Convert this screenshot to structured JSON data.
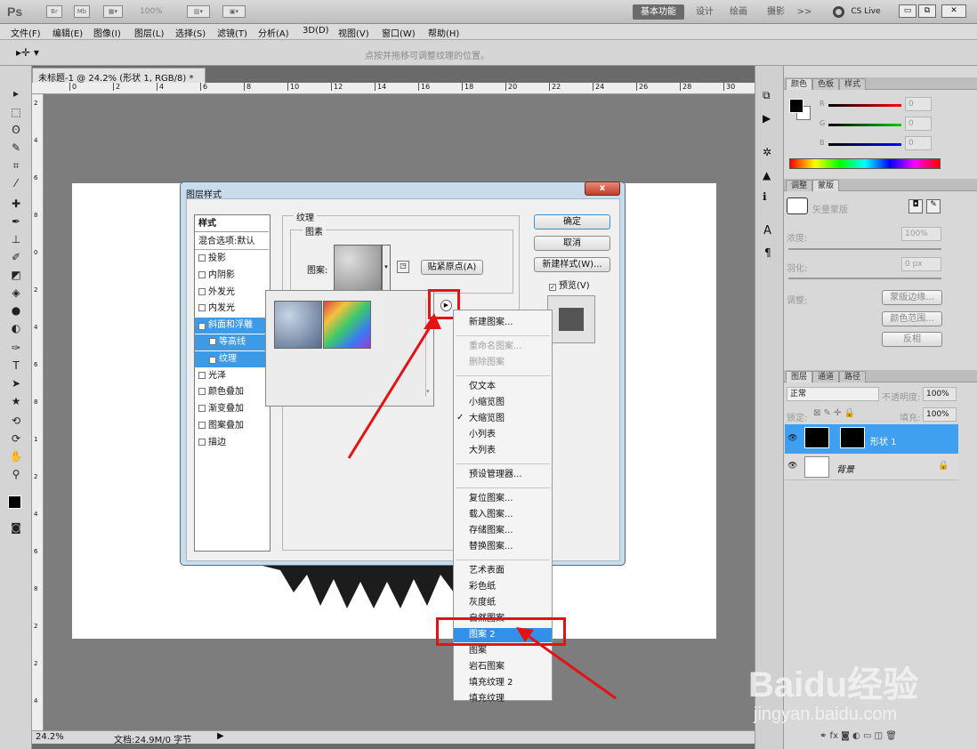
{
  "app": {
    "logo": "Ps",
    "zoom_select": "100%"
  },
  "workspaces": [
    {
      "label": "基本功能",
      "active": true
    },
    {
      "label": "设计"
    },
    {
      "label": "绘画"
    },
    {
      "label": "摄影"
    },
    {
      "label": ">>"
    },
    {
      "label": "CS Live"
    }
  ],
  "menubar": [
    "文件(F)",
    "编辑(E)",
    "图像(I)",
    "图层(L)",
    "选择(S)",
    "滤镜(T)",
    "分析(A)",
    "3D(D)",
    "视图(V)",
    "窗口(W)",
    "帮助(H)"
  ],
  "options_hint": "点按并拖移可调整纹理的位置。",
  "document": {
    "tab_title": "未标题-1 @ 24.2% (形状 1, RGB/8) *",
    "ruler_top": [
      "0",
      "2",
      "4",
      "6",
      "8",
      "10",
      "12",
      "14",
      "16",
      "18",
      "20",
      "22",
      "24",
      "26",
      "28",
      "30"
    ],
    "ruler_left": [
      "2",
      "4",
      "6",
      "8",
      "0",
      "2",
      "4",
      "6",
      "8",
      "1",
      "2",
      "4",
      "6",
      "8",
      "2",
      "2",
      "4"
    ],
    "status_zoom": "24.2%",
    "status_doc": "文档:24.9M/0 字节"
  },
  "color_panel": {
    "tabs": [
      "颜色",
      "色板",
      "样式"
    ],
    "channels": [
      {
        "label": "R",
        "value": "0"
      },
      {
        "label": "G",
        "value": "0"
      },
      {
        "label": "B",
        "value": "0"
      }
    ]
  },
  "masks_panel": {
    "tabs": [
      "调整",
      "蒙版"
    ],
    "mask_label": "矢量蒙版",
    "density_label": "浓度:",
    "density_value": "100%",
    "feather_label": "羽化:",
    "feather_value": "0 px",
    "refine_label": "调整:",
    "buttons": [
      "蒙版边缘...",
      "颜色范围...",
      "反相"
    ]
  },
  "layers_panel": {
    "tabs": [
      "图层",
      "通道",
      "路径"
    ],
    "blend_mode": "正常",
    "opacity_label": "不透明度:",
    "opacity_value": "100%",
    "lock_label": "锁定:",
    "fill_label": "填充:",
    "fill_value": "100%",
    "layers": [
      {
        "name": "形状 1",
        "selected": true
      },
      {
        "name": "背景",
        "selected": false
      }
    ]
  },
  "dialog": {
    "title": "图层样式",
    "close_label": "x",
    "styles_header": "样式",
    "blend_options": "混合选项:默认",
    "styles": [
      {
        "label": "投影",
        "checked": false
      },
      {
        "label": "内阴影",
        "checked": false
      },
      {
        "label": "外发光",
        "checked": false
      },
      {
        "label": "内发光",
        "checked": false
      },
      {
        "label": "斜面和浮雕",
        "checked": true,
        "selected": true
      },
      {
        "label": "等高线",
        "checked": false,
        "selected": true
      },
      {
        "label": "纹理",
        "checked": true,
        "selected": true
      },
      {
        "label": "光泽",
        "checked": false
      },
      {
        "label": "颜色叠加",
        "checked": false
      },
      {
        "label": "渐变叠加",
        "checked": false
      },
      {
        "label": "图案叠加",
        "checked": false
      },
      {
        "label": "描边",
        "checked": false
      }
    ],
    "section_title": "纹理",
    "group_title": "图素",
    "pattern_label": "图案:",
    "snap_button": "贴紧原点(A)",
    "ok": "确定",
    "cancel": "取消",
    "new_style": "新建样式(W)...",
    "preview_label": "预览(V)",
    "preview_checked": true
  },
  "context_menu": [
    {
      "label": "新建图案...",
      "group": 1
    },
    {
      "label": "重命名图案...",
      "disabled": true,
      "group": 2
    },
    {
      "label": "删除图案",
      "disabled": true,
      "group": 2
    },
    {
      "label": "仅文本",
      "group": 3
    },
    {
      "label": "小缩览图",
      "group": 3
    },
    {
      "label": "大缩览图",
      "checked": true,
      "group": 3
    },
    {
      "label": "小列表",
      "group": 3
    },
    {
      "label": "大列表",
      "group": 3
    },
    {
      "label": "预设管理器...",
      "group": 4
    },
    {
      "label": "复位图案...",
      "group": 5
    },
    {
      "label": "载入图案...",
      "group": 5
    },
    {
      "label": "存储图案...",
      "group": 5
    },
    {
      "label": "替换图案...",
      "group": 5
    },
    {
      "label": "艺术表面",
      "group": 6
    },
    {
      "label": "彩色纸",
      "group": 6
    },
    {
      "label": "灰度纸",
      "group": 6
    },
    {
      "label": "自然图案",
      "group": 6
    },
    {
      "label": "图案 2",
      "highlighted": true,
      "group": 6
    },
    {
      "label": "图案",
      "group": 6
    },
    {
      "label": "岩石图案",
      "group": 6
    },
    {
      "label": "填充纹理 2",
      "group": 6
    },
    {
      "label": "填充纹理",
      "group": 6
    }
  ],
  "watermark": {
    "brand": "Baidu经验",
    "url": "jingyan.baidu.com"
  },
  "colors": {
    "accent": "#3390e8",
    "annotation": "#e31313"
  }
}
